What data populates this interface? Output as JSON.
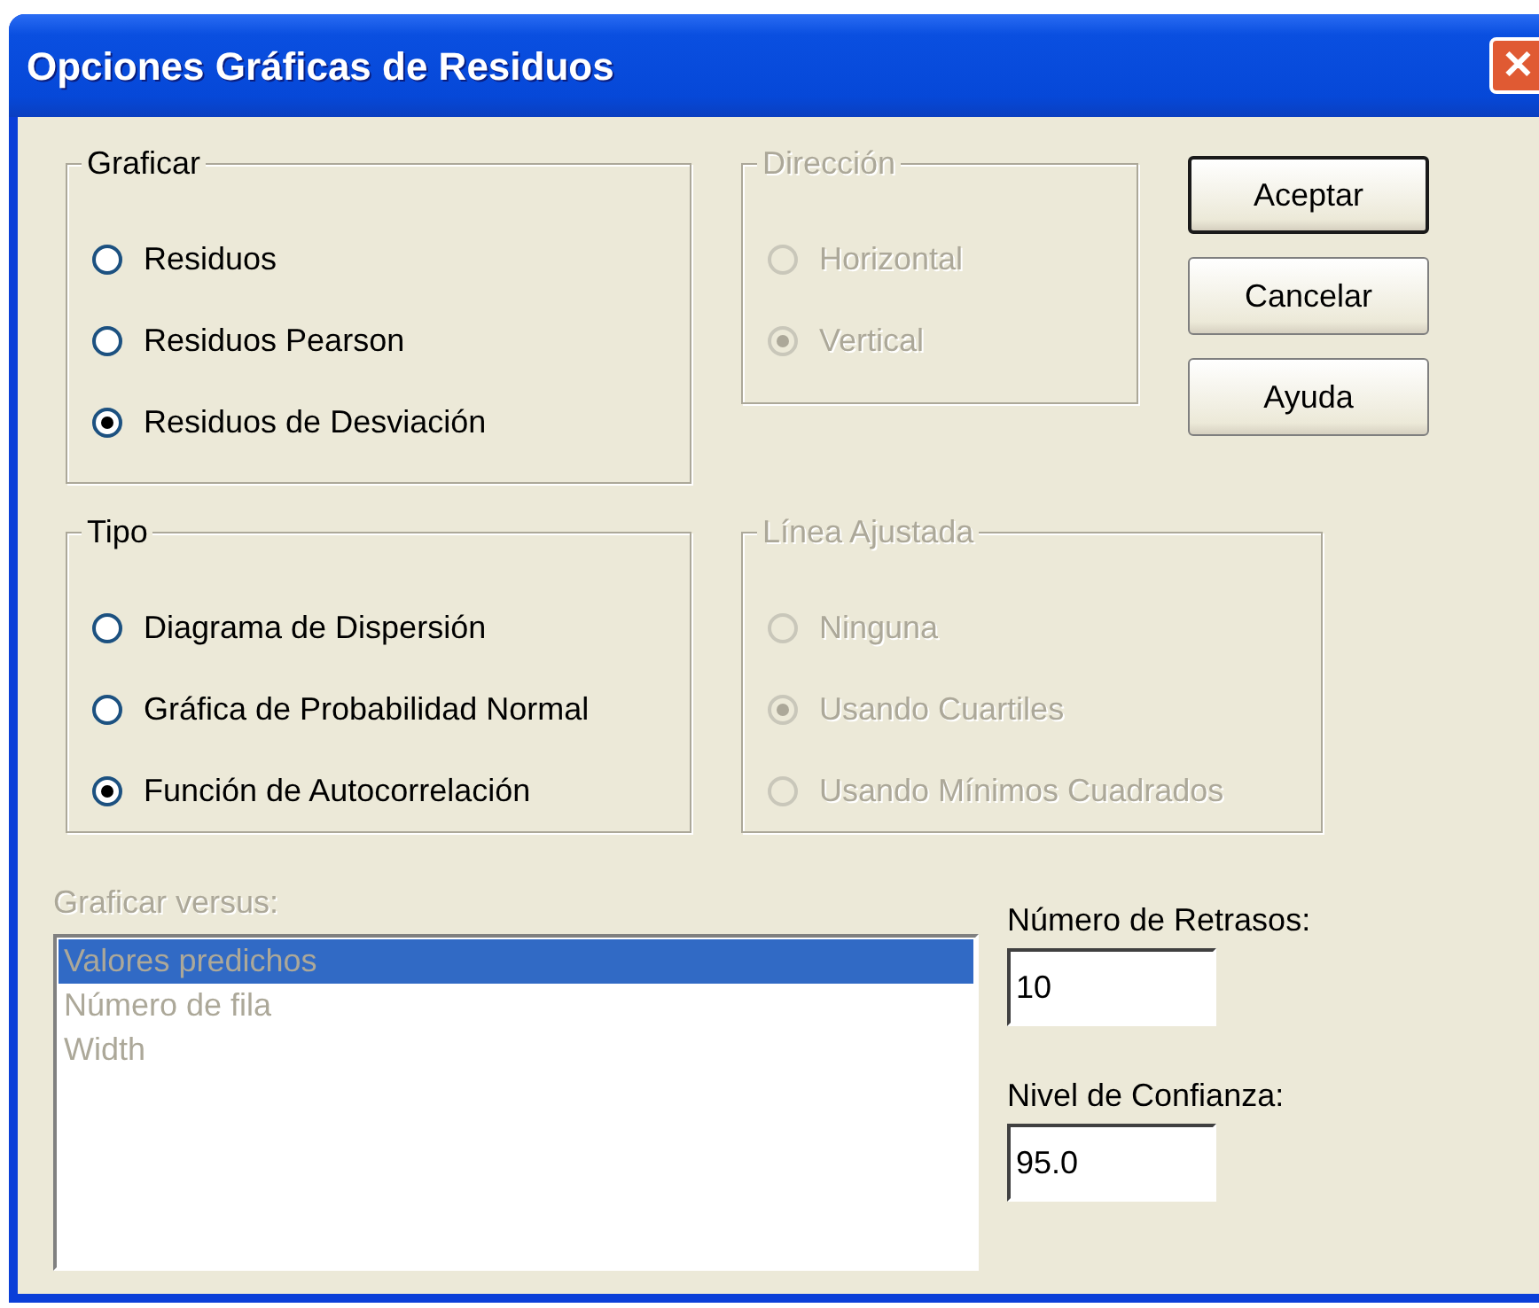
{
  "window": {
    "title": "Opciones Gráficas de Residuos",
    "close": "✕"
  },
  "groups": [
    {
      "title": "Graficar",
      "disabled": false,
      "options": [
        {
          "label": "Residuos",
          "selected": false
        },
        {
          "label": "Residuos Pearson",
          "selected": false
        },
        {
          "label": "Residuos de Desviación",
          "selected": true
        }
      ]
    },
    {
      "title": "Dirección",
      "disabled": true,
      "options": [
        {
          "label": "Horizontal",
          "selected": false
        },
        {
          "label": "Vertical",
          "selected": true
        }
      ]
    },
    {
      "title": "Tipo",
      "disabled": false,
      "options": [
        {
          "label": "Diagrama de Dispersión",
          "selected": false
        },
        {
          "label": "Gráfica de Probabilidad Normal",
          "selected": false
        },
        {
          "label": "Función de Autocorrelación",
          "selected": true
        }
      ]
    },
    {
      "title": "Línea Ajustada",
      "disabled": true,
      "options": [
        {
          "label": "Ninguna",
          "selected": false
        },
        {
          "label": "Usando Cuartiles",
          "selected": true
        },
        {
          "label": "Usando Mínimos Cuadrados",
          "selected": false
        }
      ]
    }
  ],
  "buttons": [
    {
      "label": "Aceptar",
      "default": true
    },
    {
      "label": "Cancelar",
      "default": false
    },
    {
      "label": "Ayuda",
      "default": false
    }
  ],
  "versus": {
    "label": "Graficar versus:",
    "disabled": true,
    "items": [
      {
        "label": "Valores predichos",
        "selected": true
      },
      {
        "label": "Número de fila",
        "selected": false
      },
      {
        "label": "Width",
        "selected": false
      }
    ]
  },
  "fields": [
    {
      "label": "Número de Retrasos:",
      "value": "10"
    },
    {
      "label": "Nivel de Confianza:",
      "value": "95.0"
    }
  ]
}
